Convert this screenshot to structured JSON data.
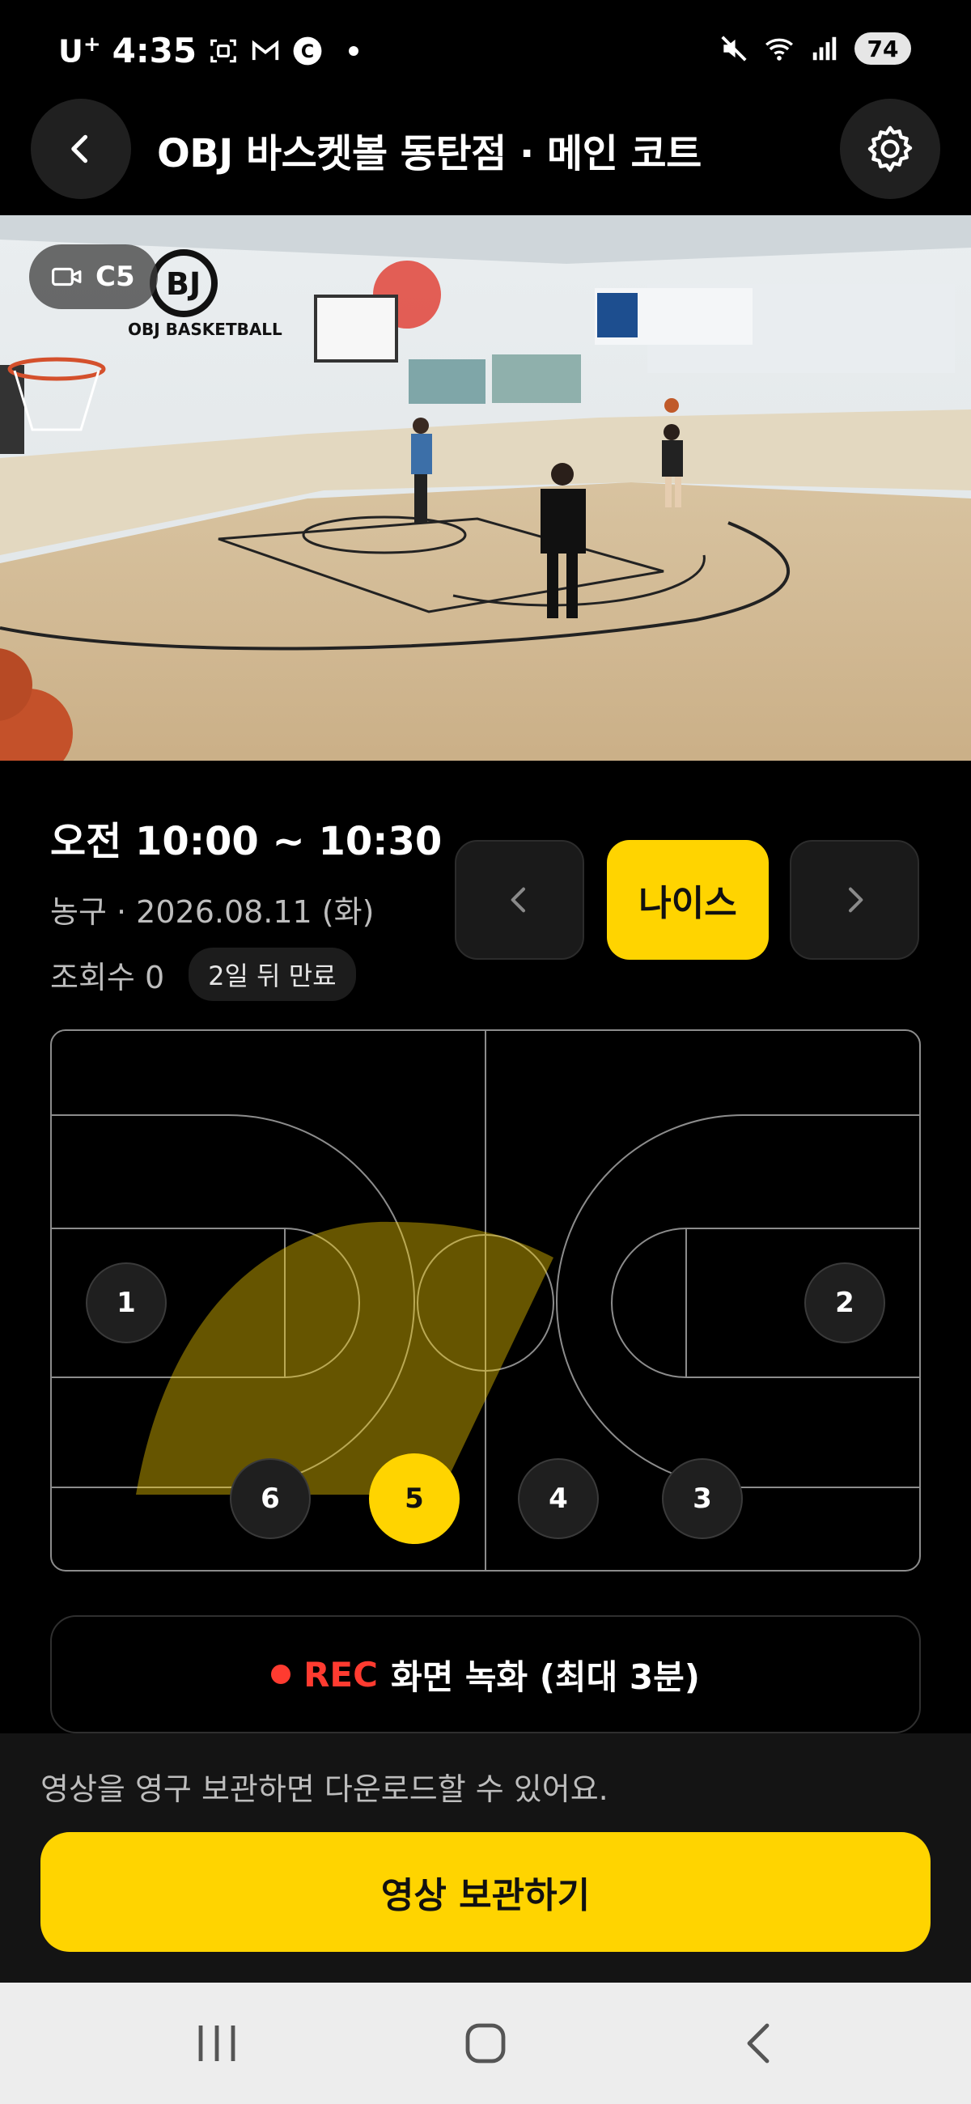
{
  "status_bar": {
    "carrier": "U",
    "carrier_sup": "+",
    "time": "4:35",
    "battery": "74"
  },
  "header": {
    "title": "OBJ 바스켓볼 동탄점 · 메인 코트"
  },
  "video": {
    "camera_label": "C5"
  },
  "session": {
    "time_range": "오전 10:00 ~ 10:30",
    "meta": "농구 · 2026.08.11 (화)",
    "views": "조회수 0",
    "expire_badge": "2일 뒤 만료"
  },
  "nav": {
    "nice_label": "나이스"
  },
  "court": {
    "spots": [
      {
        "label": "1",
        "active": false
      },
      {
        "label": "2",
        "active": false
      },
      {
        "label": "3",
        "active": false
      },
      {
        "label": "4",
        "active": false
      },
      {
        "label": "5",
        "active": true
      },
      {
        "label": "6",
        "active": false
      }
    ]
  },
  "record": {
    "rec_label": "REC",
    "text": "화면 녹화 (최대 3분)"
  },
  "bottom": {
    "notice": "영상을 영구 보관하면 다운로드할 수 있어요.",
    "save_button": "영상 보관하기"
  },
  "colors": {
    "accent": "#ffd400",
    "rec": "#ff3b30",
    "background": "#000000"
  }
}
